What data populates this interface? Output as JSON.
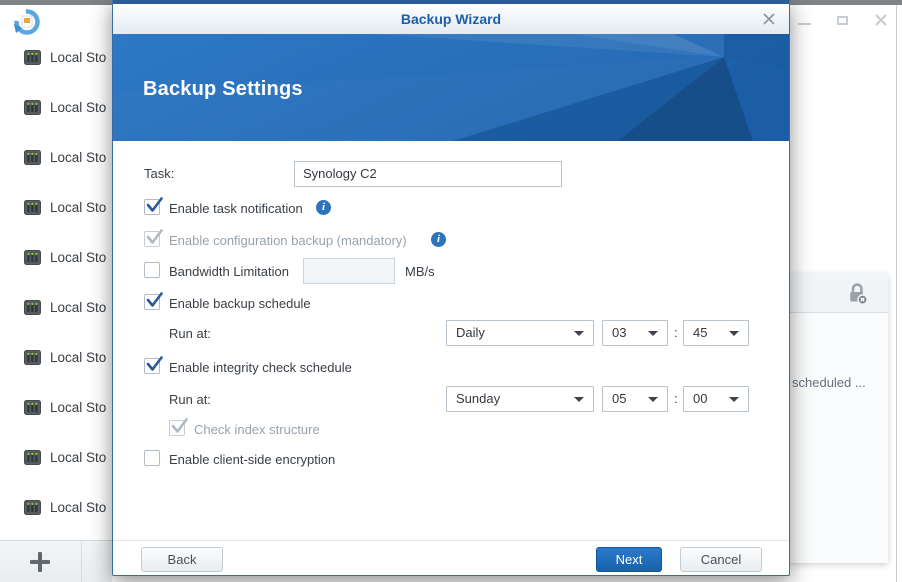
{
  "background": {
    "app_icon": "hyper-backup-icon",
    "storage_items": [
      "Local Sto",
      "Local Sto",
      "Local Sto",
      "Local Sto",
      "Local Sto",
      "Local Sto",
      "Local Sto",
      "Local Sto",
      "Local Sto",
      "Local Sto"
    ],
    "add_icon": "plus-icon",
    "right_panel": {
      "lock_icon": "lock-unencrypted-icon",
      "text": "scheduled ..."
    },
    "window_controls": {
      "minimize_icon": "minimize-icon",
      "maximize_icon": "maximize-icon",
      "close_icon": "close-icon"
    }
  },
  "dialog": {
    "title": "Backup Wizard",
    "close_icon": "close-x-icon",
    "header_title": "Backup Settings",
    "form": {
      "task_label": "Task:",
      "task_value": "Synology C2",
      "enable_task_notification": {
        "label": "Enable task notification",
        "checked": true,
        "info_icon": "info-icon"
      },
      "enable_configuration_backup": {
        "label": "Enable configuration backup (mandatory)",
        "checked": true,
        "disabled": true,
        "info_icon": "info-icon"
      },
      "bandwidth_limitation": {
        "label": "Bandwidth Limitation",
        "checked": false,
        "value": "",
        "unit": "MB/s"
      },
      "enable_backup_schedule": {
        "label": "Enable backup schedule",
        "checked": true
      },
      "backup_run_at": {
        "label": "Run at:",
        "frequency": "Daily",
        "hour": "03",
        "colon": ":",
        "minute": "45"
      },
      "enable_integrity_check": {
        "label": "Enable integrity check schedule",
        "checked": true
      },
      "integrity_run_at": {
        "label": "Run at:",
        "frequency": "Sunday",
        "hour": "05",
        "colon": ":",
        "minute": "00"
      },
      "check_index_structure": {
        "label": "Check index structure",
        "checked": true,
        "disabled": true
      },
      "enable_client_side_encryption": {
        "label": "Enable client-side encryption",
        "checked": false
      }
    },
    "footer": {
      "back": "Back",
      "next": "Next",
      "cancel": "Cancel"
    }
  },
  "colors": {
    "header_blue": "#2270be",
    "accent_blue": "#1a6bbb",
    "check_blue": "#2a5a9b",
    "title_text_blue": "#1d5fa6"
  }
}
